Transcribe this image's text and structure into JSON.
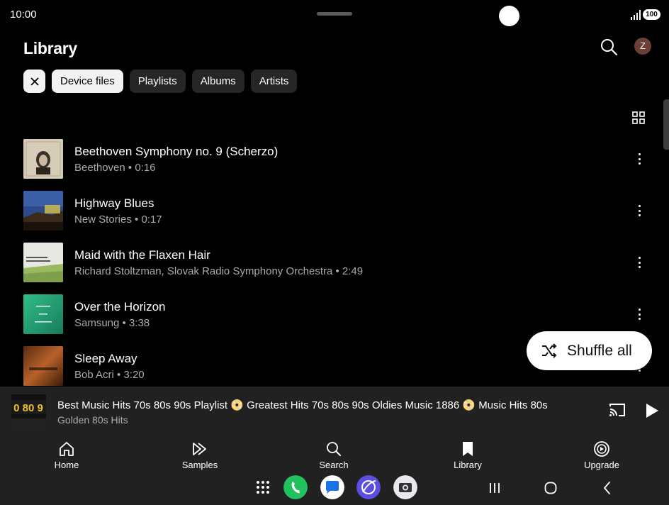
{
  "status_bar": {
    "time": "10:00",
    "battery": "100"
  },
  "header": {
    "title": "Library",
    "avatar_initial": "Z"
  },
  "chips": [
    "Device files",
    "Playlists",
    "Albums",
    "Artists"
  ],
  "tracks": [
    {
      "title": "Beethoven Symphony no. 9 (Scherzo)",
      "subtitle": "Beethoven • 0:16",
      "art_label": "Beethoven"
    },
    {
      "title": "Highway Blues",
      "subtitle": "New Stories • 0:17",
      "art_label": ""
    },
    {
      "title": "Maid with the Flaxen Hair",
      "subtitle": "Richard Stoltzman, Slovak Radio Symphony Orchestra • 2:49",
      "art_label": "RICHARD STOLTZMAN"
    },
    {
      "title": "Over the Horizon",
      "subtitle": "Samsung • 3:38",
      "art_label": "OVER THE HORIZON"
    },
    {
      "title": "Sleep Away",
      "subtitle": "Bob Acri • 3:20",
      "art_label": ""
    }
  ],
  "shuffle": {
    "label": "Shuffle all"
  },
  "mini_player": {
    "title": "Best Music Hits 70s 80s 90s Playlist 📀 Greatest Hits 70s 80s 90s Oldies Music 1886 📀 Music Hits 80s",
    "subtitle": "Golden 80s Hits",
    "art_label": "0 80 9"
  },
  "bottom_nav": [
    {
      "label": "Home",
      "icon": "home-icon"
    },
    {
      "label": "Samples",
      "icon": "samples-icon"
    },
    {
      "label": "Search",
      "icon": "search-icon"
    },
    {
      "label": "Library",
      "icon": "library-icon"
    },
    {
      "label": "Upgrade",
      "icon": "upgrade-icon"
    }
  ],
  "colors": {
    "background": "#000000",
    "surface": "#212121",
    "chip": "#262626",
    "chip_active": "#f2f2f2",
    "avatar": "#6b3f35"
  }
}
